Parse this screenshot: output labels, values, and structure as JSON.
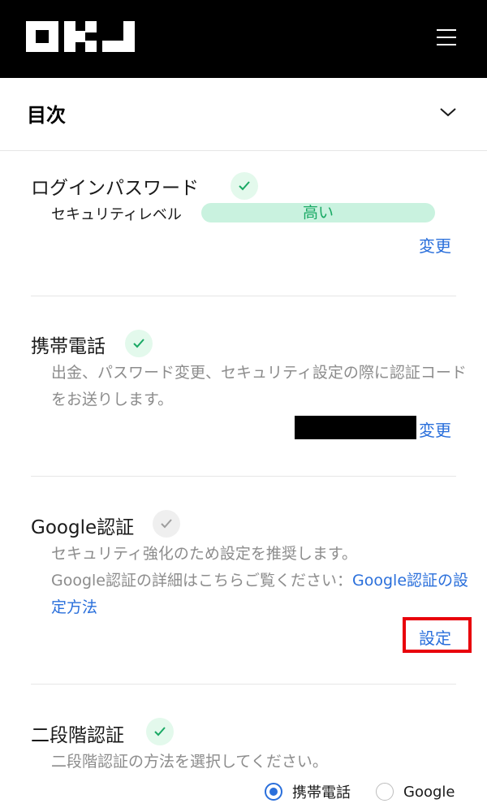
{
  "header": {
    "logo_text": "OKJ",
    "menu_icon": "hamburger-menu-icon"
  },
  "toc": {
    "title": "目次",
    "chevron_icon": "chevron-down-icon"
  },
  "login_password": {
    "title": "ログインパスワード",
    "status_icon": "check-icon",
    "level_label": "セキュリティレベル",
    "level_value": "高い",
    "action_label": "変更"
  },
  "mobile": {
    "title": "携帯電話",
    "status_icon": "check-icon",
    "description": "出金、パスワード変更、セキュリティ設定の際に認証コードをお送りします。",
    "action_label": "変更"
  },
  "google_auth": {
    "title": "Google認証",
    "status_icon": "check-icon",
    "description_1": "セキュリティ強化のため設定を推奨します。",
    "description_2": "Google認証の詳細はこちらご覧ください：",
    "link_label": "Google認証の設定方法",
    "action_label": "設定"
  },
  "two_factor": {
    "title": "二段階認証",
    "status_icon": "check-icon",
    "description": "二段階認証の方法を選択してください。",
    "options": [
      {
        "label": "携帯電話",
        "selected": true
      },
      {
        "label": "Google",
        "selected": false
      }
    ]
  },
  "colors": {
    "accent": "#2a6fdb",
    "success": "#19a964",
    "highlight": "#e8000b"
  }
}
